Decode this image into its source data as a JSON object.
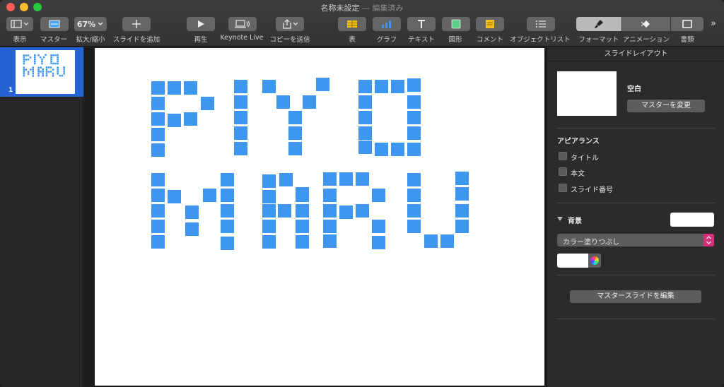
{
  "window": {
    "title": "名称未設定",
    "subtitle": "— 編集済み"
  },
  "toolbar": {
    "view_label": "表示",
    "master_label": "マスター",
    "zoom_value": "67%",
    "zoom_label": "拡大/縮小",
    "add_slide_label": "スライドを追加",
    "play_label": "再生",
    "keynote_live_label": "Keynote Live",
    "share_label": "コピーを送信",
    "table_label": "表",
    "chart_label": "グラフ",
    "text_label": "テキスト",
    "shape_label": "図形",
    "comment_label": "コメント",
    "object_list_label": "オブジェクトリスト",
    "format_label": "フォーマット",
    "animate_label": "アニメーション",
    "document_label": "書類",
    "more_label": "»"
  },
  "navigator": {
    "slide_number": "1",
    "thumb_text": "PIYO\nMARU"
  },
  "inspector": {
    "header": "スライドレイアウト",
    "layout_name": "空白",
    "change_master": "マスターを変更",
    "appearance_title": "アピアランス",
    "checkbox_title": "タイトル",
    "checkbox_body": "本文",
    "checkbox_slide_number": "スライド番号",
    "background_title": "背景",
    "fill_type": "カラー塗りつぶし",
    "edit_master": "マスタースライドを編集"
  },
  "colors": {
    "square_blue": "#3d97f2",
    "selection_blue": "#2462d4",
    "background_fill": "#ffffff"
  },
  "slide_text": "PIYO MARU"
}
